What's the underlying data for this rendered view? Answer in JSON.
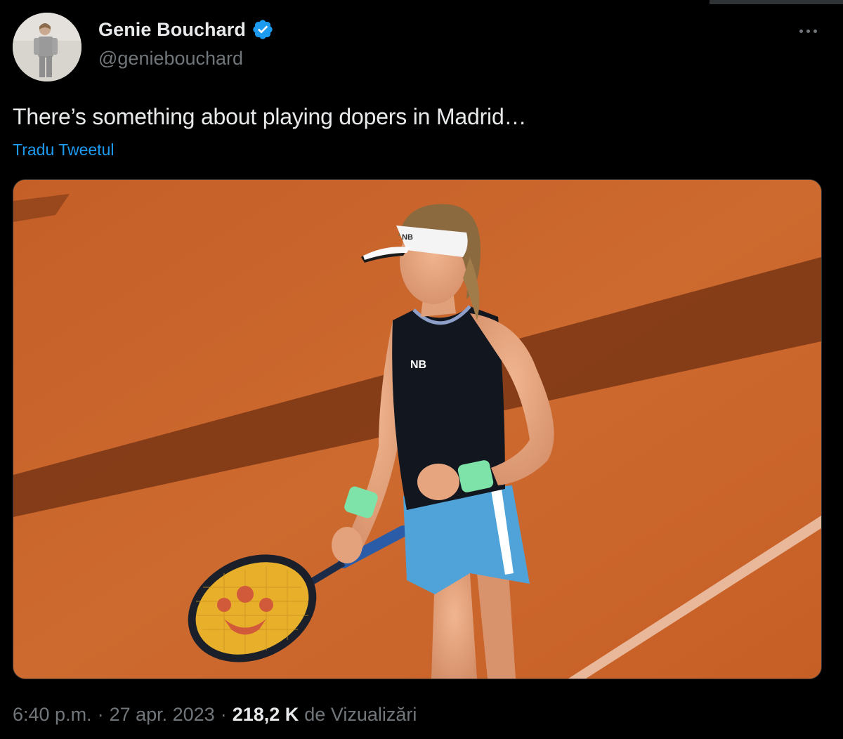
{
  "author": {
    "display_name": "Genie Bouchard",
    "handle": "@geniebouchard",
    "verified": true,
    "avatar_icon": "profile-photo"
  },
  "tweet": {
    "text": "There’s something about playing dopers in Madrid…",
    "translate_label": "Tradu Tweetul"
  },
  "meta": {
    "time": "6:40 p.m.",
    "separator1": "·",
    "date": "27 apr. 2023",
    "separator2": "·",
    "views_count": "218,2 K",
    "views_label": "de Vizualizări"
  },
  "icons": {
    "verified": "verified-badge-icon",
    "more": "more-options-icon"
  },
  "colors": {
    "background": "#000000",
    "text": "#e7e9ea",
    "secondary": "#71767b",
    "link": "#1d9bf0",
    "verified": "#1d9bf0",
    "clay": "#c9652a"
  }
}
